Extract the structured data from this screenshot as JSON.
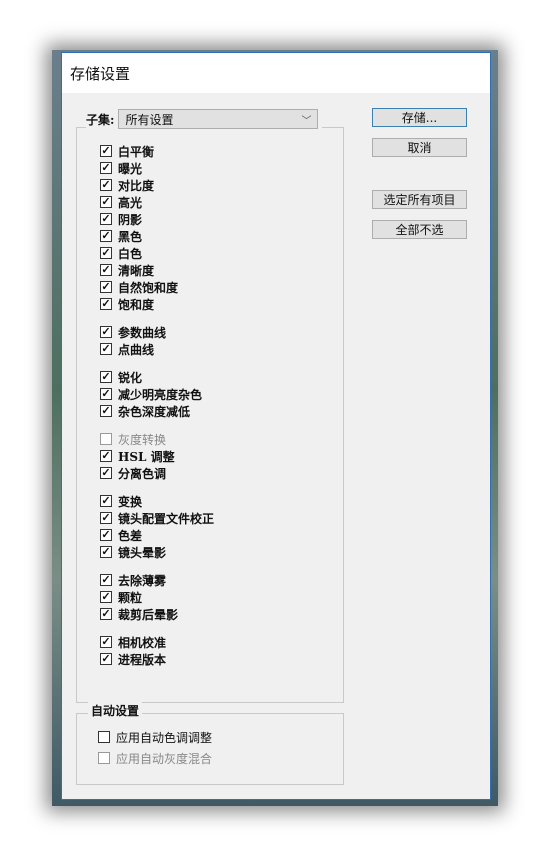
{
  "dialog": {
    "title": "存储设置"
  },
  "subset": {
    "label": "子集:",
    "selected": "所有设置"
  },
  "buttons": {
    "save": "存储...",
    "cancel": "取消",
    "select_all": "选定所有项目",
    "select_none": "全部不选"
  },
  "groups": [
    {
      "items": [
        {
          "label": "白平衡",
          "checked": true
        },
        {
          "label": "曝光",
          "checked": true
        },
        {
          "label": "对比度",
          "checked": true
        },
        {
          "label": "高光",
          "checked": true
        },
        {
          "label": "阴影",
          "checked": true
        },
        {
          "label": "黑色",
          "checked": true
        },
        {
          "label": "白色",
          "checked": true
        },
        {
          "label": "清晰度",
          "checked": true
        },
        {
          "label": "自然饱和度",
          "checked": true
        },
        {
          "label": "饱和度",
          "checked": true
        }
      ]
    },
    {
      "items": [
        {
          "label": "参数曲线",
          "checked": true
        },
        {
          "label": "点曲线",
          "checked": true
        }
      ]
    },
    {
      "items": [
        {
          "label": "锐化",
          "checked": true
        },
        {
          "label": "减少明亮度杂色",
          "checked": true
        },
        {
          "label": "杂色深度减低",
          "checked": true
        }
      ]
    },
    {
      "items": [
        {
          "label": "灰度转换",
          "checked": false,
          "disabled": true
        },
        {
          "label": "HSL 调整",
          "checked": true
        },
        {
          "label": "分离色调",
          "checked": true
        }
      ]
    },
    {
      "items": [
        {
          "label": "变换",
          "checked": true
        },
        {
          "label": "镜头配置文件校正",
          "checked": true
        },
        {
          "label": "色差",
          "checked": true
        },
        {
          "label": "镜头晕影",
          "checked": true
        }
      ]
    },
    {
      "items": [
        {
          "label": "去除薄雾",
          "checked": true
        },
        {
          "label": "颗粒",
          "checked": true
        },
        {
          "label": "裁剪后晕影",
          "checked": true
        }
      ]
    },
    {
      "items": [
        {
          "label": "相机校准",
          "checked": true
        },
        {
          "label": "进程版本",
          "checked": true
        }
      ]
    }
  ],
  "auto": {
    "legend": "自动设置",
    "items": [
      {
        "label": "应用自动色调调整",
        "checked": false,
        "disabled": false
      },
      {
        "label": "应用自动灰度混合",
        "checked": false,
        "disabled": true
      }
    ]
  }
}
